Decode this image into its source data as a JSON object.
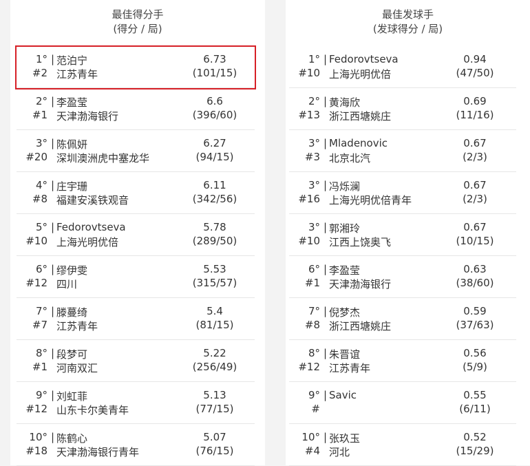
{
  "left_panel": {
    "title": "最佳得分手",
    "subtitle": "(得分 / 局)",
    "rows": [
      {
        "rank": "1°",
        "seed": "#2",
        "name": "范泊宁",
        "team": "江苏青年",
        "value": "6.73",
        "fraction": "(101/15)"
      },
      {
        "rank": "2°",
        "seed": "#1",
        "name": "李盈莹",
        "team": "天津渤海银行",
        "value": "6.6",
        "fraction": "(396/60)"
      },
      {
        "rank": "3°",
        "seed": "#20",
        "name": "陈佩妍",
        "team": "深圳澳洲虎中塞龙华",
        "value": "6.27",
        "fraction": "(94/15)"
      },
      {
        "rank": "4°",
        "seed": "#8",
        "name": "庄宇珊",
        "team": "福建安溪铁观音",
        "value": "6.11",
        "fraction": "(342/56)"
      },
      {
        "rank": "5°",
        "seed": "#10",
        "name": "Fedorovtseva",
        "team": "上海光明优倍",
        "value": "5.78",
        "fraction": "(289/50)"
      },
      {
        "rank": "6°",
        "seed": "#12",
        "name": "缪伊雯",
        "team": "四川",
        "value": "5.53",
        "fraction": "(315/57)"
      },
      {
        "rank": "7°",
        "seed": "#7",
        "name": "滕蔓绮",
        "team": "江苏青年",
        "value": "5.4",
        "fraction": "(81/15)"
      },
      {
        "rank": "8°",
        "seed": "#1",
        "name": "段梦可",
        "team": "河南双汇",
        "value": "5.22",
        "fraction": "(256/49)"
      },
      {
        "rank": "9°",
        "seed": "#12",
        "name": "刘虹菲",
        "team": "山东卡尔美青年",
        "value": "5.13",
        "fraction": "(77/15)"
      },
      {
        "rank": "10°",
        "seed": "#18",
        "name": "陈鹤心",
        "team": "天津渤海银行青年",
        "value": "5.07",
        "fraction": "(76/15)"
      }
    ]
  },
  "right_panel": {
    "title": "最佳发球手",
    "subtitle": "(发球得分 / 局)",
    "rows": [
      {
        "rank": "1°",
        "seed": "#10",
        "name": "Fedorovtseva",
        "team": "上海光明优倍",
        "value": "0.94",
        "fraction": "(47/50)"
      },
      {
        "rank": "2°",
        "seed": "#13",
        "name": "黄海欣",
        "team": "浙江西塘姚庄",
        "value": "0.69",
        "fraction": "(11/16)"
      },
      {
        "rank": "3°",
        "seed": "#3",
        "name": "Mladenovic",
        "team": "北京北汽",
        "value": "0.67",
        "fraction": "(2/3)"
      },
      {
        "rank": "3°",
        "seed": "#16",
        "name": "冯烁澜",
        "team": "上海光明优倍青年",
        "value": "0.67",
        "fraction": "(2/3)"
      },
      {
        "rank": "3°",
        "seed": "#10",
        "name": "郭湘玲",
        "team": "江西上饶奥飞",
        "value": "0.67",
        "fraction": "(10/15)"
      },
      {
        "rank": "6°",
        "seed": "#1",
        "name": "李盈莹",
        "team": "天津渤海银行",
        "value": "0.63",
        "fraction": "(38/60)"
      },
      {
        "rank": "7°",
        "seed": "#8",
        "name": "倪梦杰",
        "team": "浙江西塘姚庄",
        "value": "0.59",
        "fraction": "(37/63)"
      },
      {
        "rank": "8°",
        "seed": "#12",
        "name": "朱晋谊",
        "team": "江苏青年",
        "value": "0.56",
        "fraction": "(5/9)"
      },
      {
        "rank": "9°",
        "seed": "#",
        "name": "Savic",
        "team": "",
        "value": "0.55",
        "fraction": "(6/11)"
      },
      {
        "rank": "10°",
        "seed": "#4",
        "name": "张玖玉",
        "team": "河北",
        "value": "0.52",
        "fraction": "(15/29)"
      }
    ]
  },
  "separator": "|",
  "highlight_color": "#d61f26"
}
